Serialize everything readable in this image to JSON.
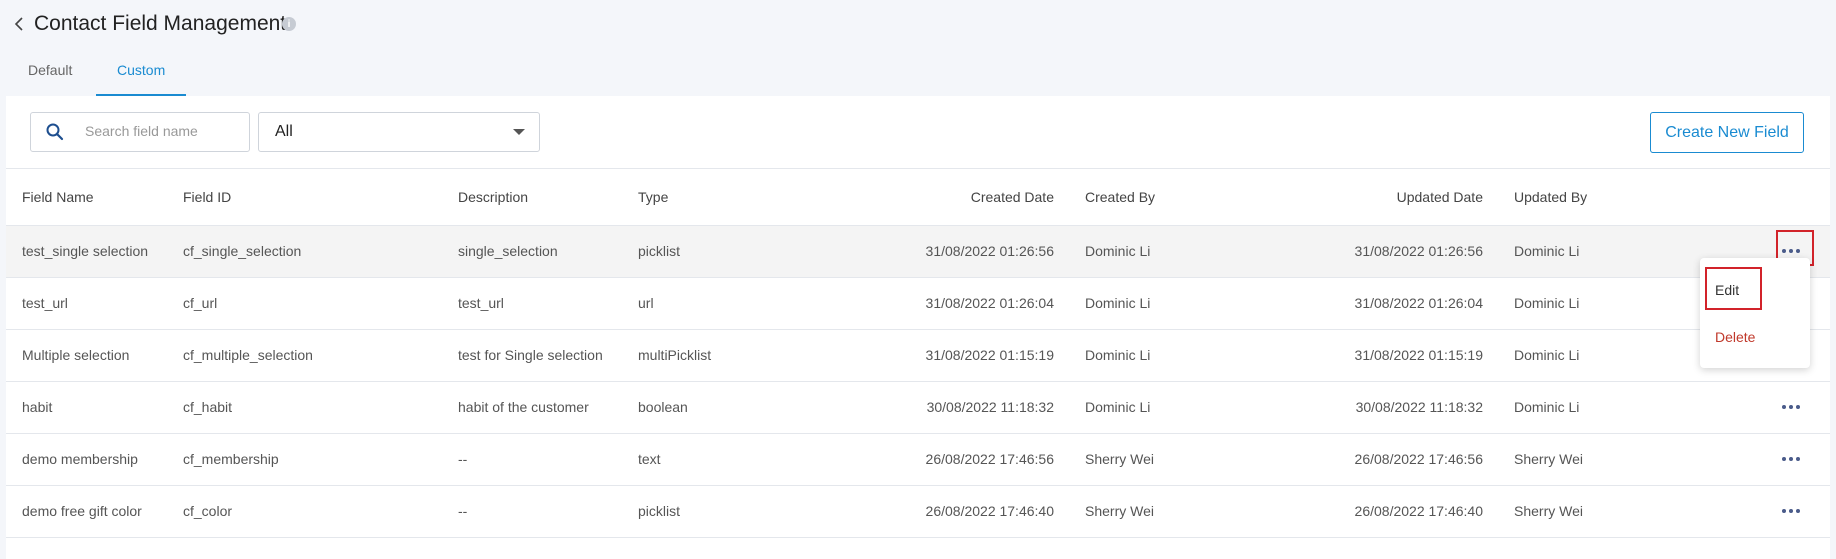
{
  "header": {
    "title": "Contact Field Management"
  },
  "tabs": [
    {
      "label": "Default"
    },
    {
      "label": "Custom"
    }
  ],
  "toolbar": {
    "search_placeholder": "Search field name",
    "filter_value": "All",
    "create_label": "Create New Field"
  },
  "table": {
    "headers": {
      "name": "Field Name",
      "id": "Field ID",
      "desc": "Description",
      "type": "Type",
      "cdate": "Created Date",
      "cby": "Created By",
      "udate": "Updated Date",
      "uby": "Updated By"
    },
    "rows": [
      {
        "name": "test_single selection",
        "id": "cf_single_selection",
        "desc": "single_selection",
        "type": "picklist",
        "cdate": "31/08/2022  01:26:56",
        "cby": "Dominic Li",
        "udate": "31/08/2022  01:26:56",
        "uby": "Dominic Li"
      },
      {
        "name": "test_url",
        "id": "cf_url",
        "desc": "test_url",
        "type": "url",
        "cdate": "31/08/2022  01:26:04",
        "cby": "Dominic Li",
        "udate": "31/08/2022  01:26:04",
        "uby": "Dominic Li"
      },
      {
        "name": "Multiple selection",
        "id": "cf_multiple_selection",
        "desc": "test for Single selection",
        "type": "multiPicklist",
        "cdate": "31/08/2022  01:15:19",
        "cby": "Dominic Li",
        "udate": "31/08/2022  01:15:19",
        "uby": "Dominic Li"
      },
      {
        "name": "habit",
        "id": "cf_habit",
        "desc": "habit of the customer",
        "type": "boolean",
        "cdate": "30/08/2022  11:18:32",
        "cby": "Dominic Li",
        "udate": "30/08/2022  11:18:32",
        "uby": "Dominic Li"
      },
      {
        "name": "demo membership",
        "id": "cf_membership",
        "desc": "--",
        "type": "text",
        "cdate": "26/08/2022  17:46:56",
        "cby": "Sherry Wei",
        "udate": "26/08/2022  17:46:56",
        "uby": "Sherry Wei"
      },
      {
        "name": "demo free gift color",
        "id": "cf_color",
        "desc": "--",
        "type": "picklist",
        "cdate": "26/08/2022  17:46:40",
        "cby": "Sherry Wei",
        "udate": "26/08/2022  17:46:40",
        "uby": "Sherry Wei"
      }
    ]
  },
  "menu": {
    "edit_label": "Edit",
    "delete_label": "Delete"
  },
  "colors": {
    "accent": "#1a8bd1",
    "highlight": "#d2232a",
    "delete": "#c0392b"
  }
}
